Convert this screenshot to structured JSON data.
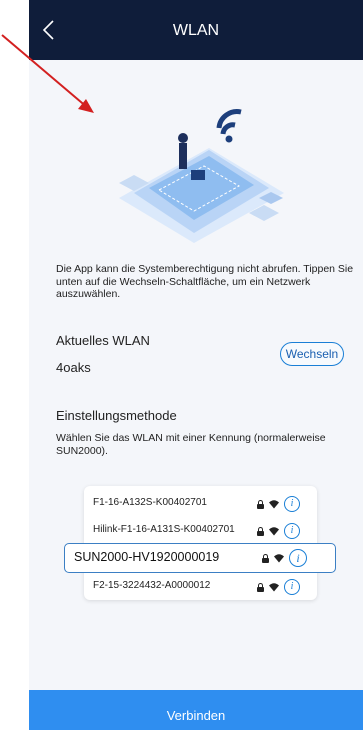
{
  "header": {
    "title": "WLAN",
    "back_icon": "chevron-left-icon"
  },
  "description": "Die App kann die Systemberechtigung nicht abrufen. Tippen Sie unten auf die Wechseln-Schaltfläche, um ein Netzwerk auszuwählen.",
  "current": {
    "label": "Aktuelles WLAN",
    "name": "4oaks",
    "switch_label": "Wechseln"
  },
  "method": {
    "label": "Einstellungsmethode",
    "description": "Wählen Sie das WLAN mit einer Kennung (normalerweise SUN2000)."
  },
  "networks": [
    {
      "name": "F1-16-A132S-K00402701"
    },
    {
      "name": "Hilink-F1-16-A131S-K00402701"
    },
    {
      "name": "SUN2000-HV1920000019"
    },
    {
      "name": "F2-15-3224432-A0000012"
    }
  ],
  "connect_label": "Verbinden",
  "colors": {
    "header": "#0f1d3a",
    "accent": "#2f8ef0",
    "annotation_arrow": "#d32020"
  }
}
